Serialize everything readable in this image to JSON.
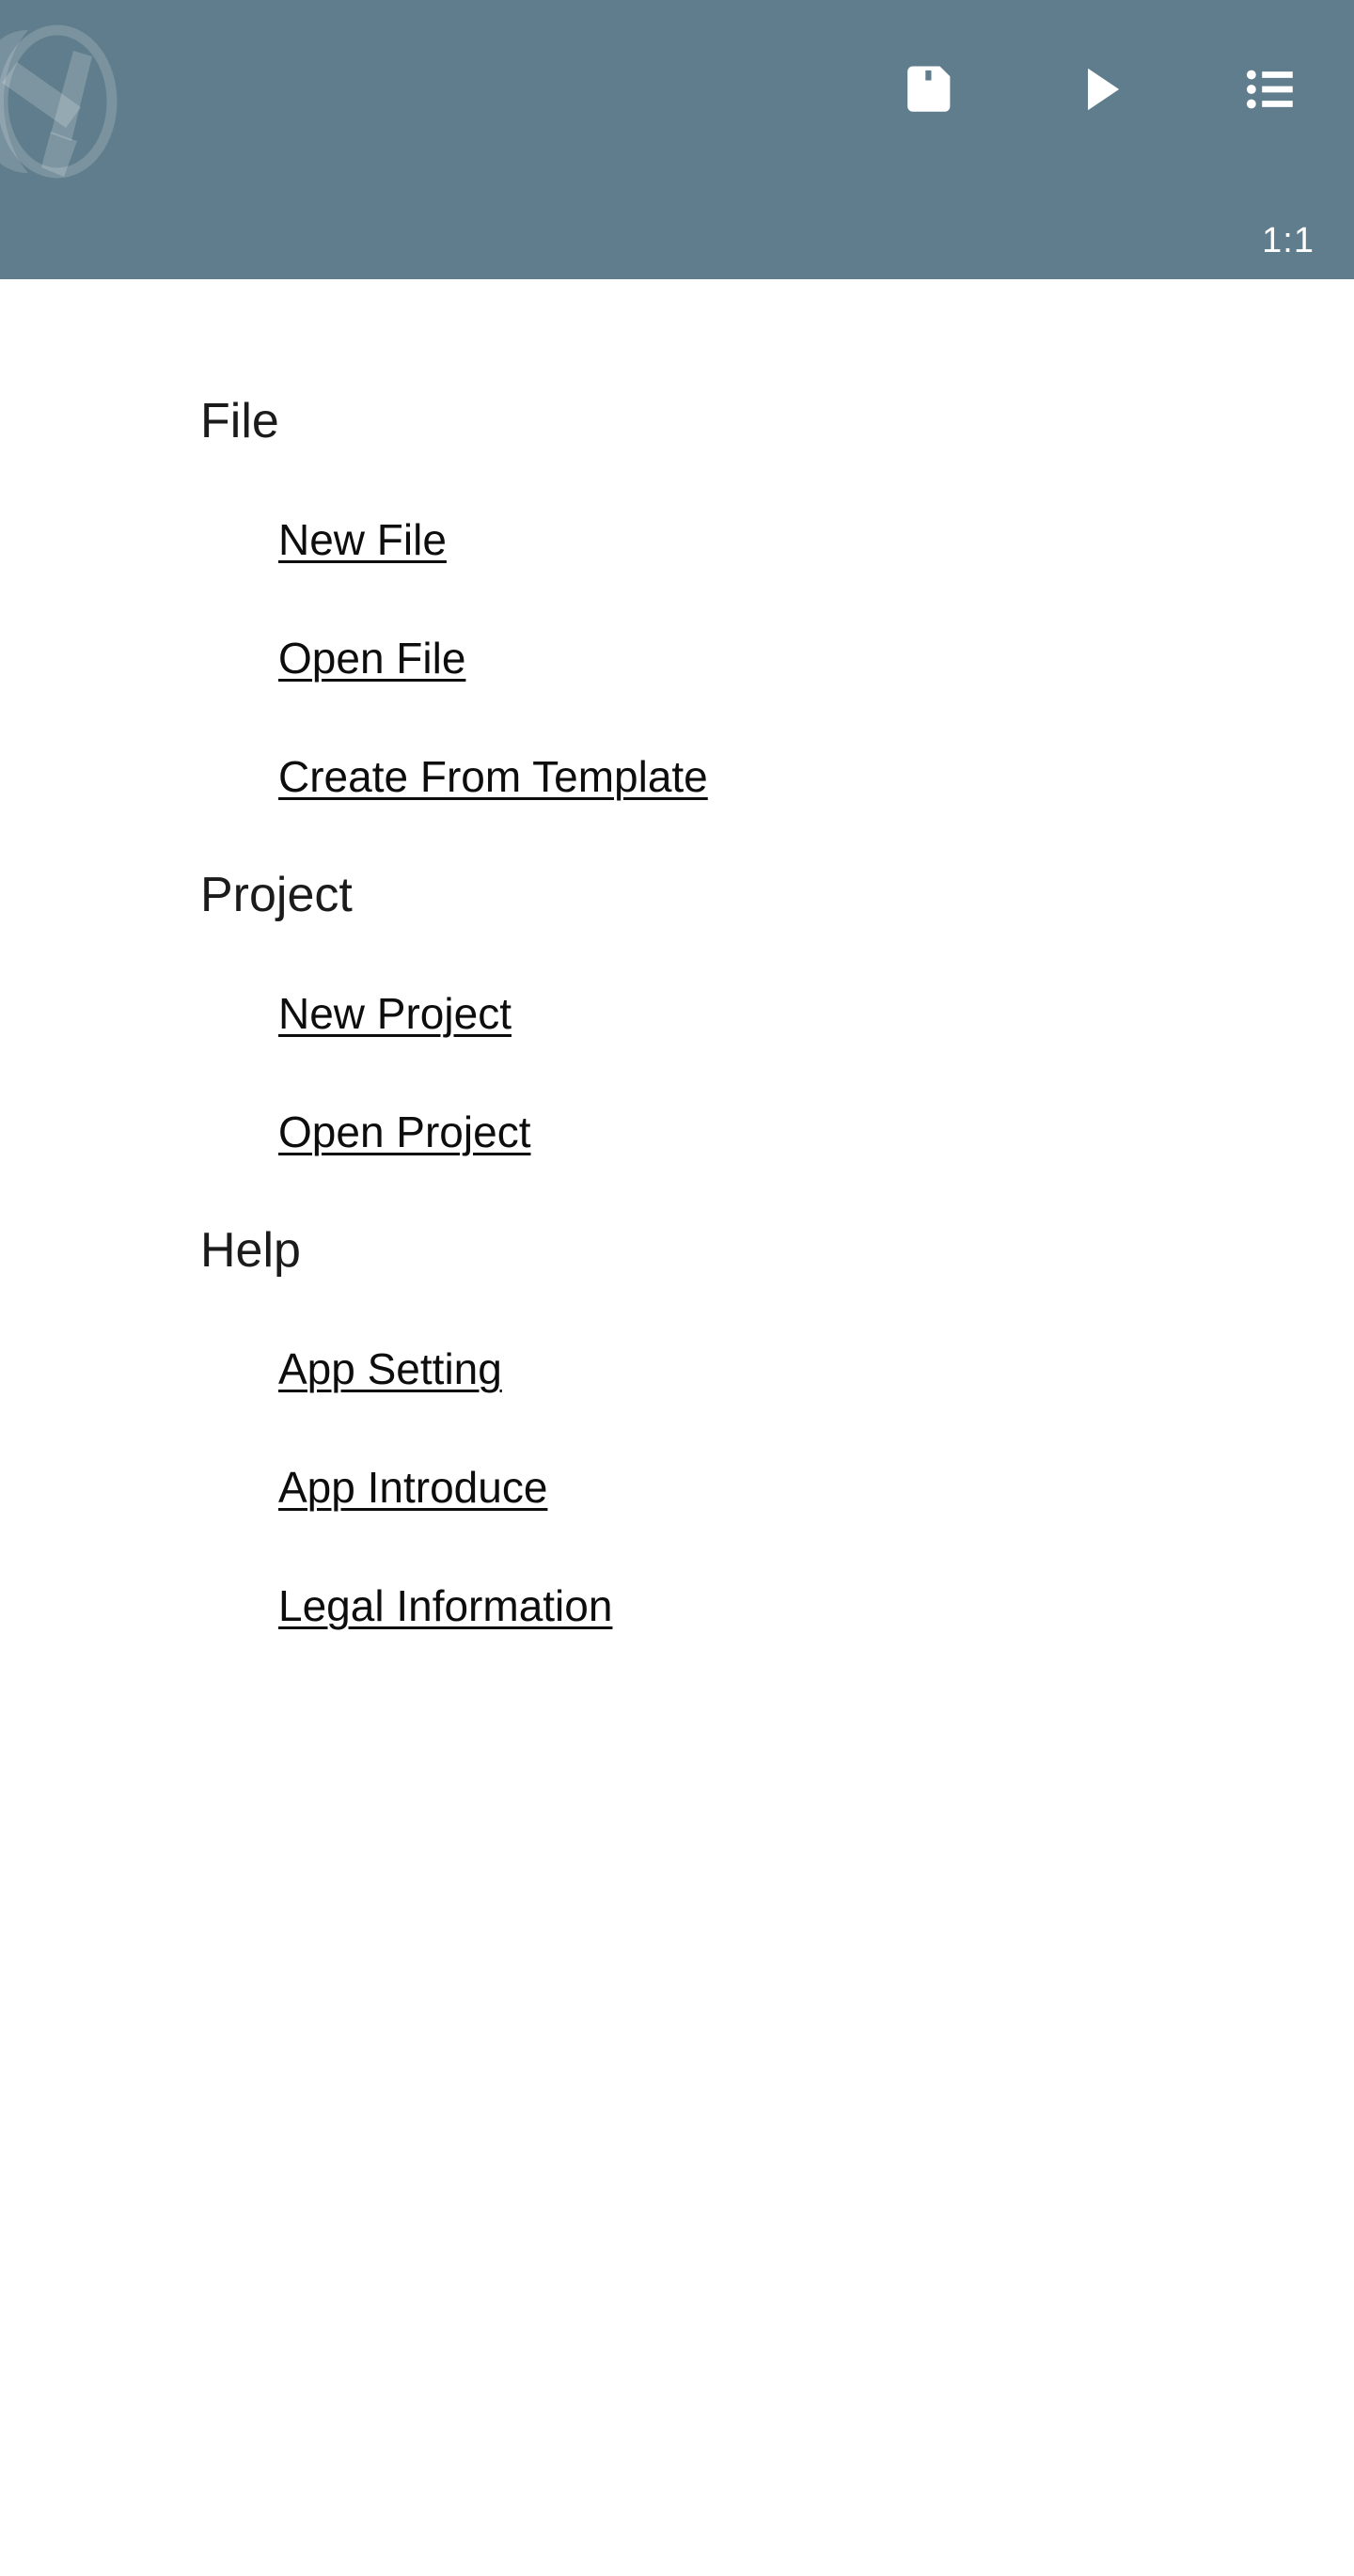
{
  "app": {
    "logo_icon": "app-logo-watermark",
    "header_color": "#5f7d8c",
    "text_color": "#0d0d0d"
  },
  "toolbar": {
    "buttons": [
      {
        "name": "save",
        "icon": "save-floppy-icon",
        "label": "Save"
      },
      {
        "name": "run",
        "icon": "play-icon",
        "label": "Run"
      },
      {
        "name": "menu",
        "icon": "list-menu-icon",
        "label": "Menu"
      }
    ],
    "zoom_level": "1:1"
  },
  "menu": {
    "sections": [
      {
        "title": "File",
        "items": [
          {
            "label": "New File"
          },
          {
            "label": "Open File"
          },
          {
            "label": "Create From Template"
          }
        ]
      },
      {
        "title": "Project",
        "items": [
          {
            "label": "New Project"
          },
          {
            "label": "Open Project"
          }
        ]
      },
      {
        "title": "Help",
        "items": [
          {
            "label": "App Setting"
          },
          {
            "label": "App Introduce"
          },
          {
            "label": "Legal Information"
          }
        ]
      }
    ]
  }
}
